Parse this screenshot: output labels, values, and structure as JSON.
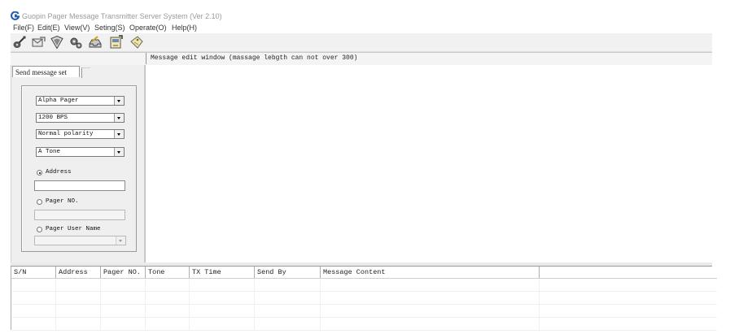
{
  "window": {
    "title": "Guopin Pager   Message Transmitter Server System (Ver 2.10)"
  },
  "menu": [
    {
      "label": "File(F)"
    },
    {
      "label": "Edit(E)"
    },
    {
      "label": "View(V)"
    },
    {
      "label": "Seting(S)"
    },
    {
      "label": "Operate(O)"
    },
    {
      "label": "Help(H)"
    }
  ],
  "toolbar": {
    "buttons": [
      {
        "icon": "guitar-icon"
      },
      {
        "icon": "send-message-icon"
      },
      {
        "icon": "shield-icon"
      },
      {
        "icon": "gears-icon"
      },
      {
        "icon": "inbox-icon"
      },
      {
        "icon": "export-icon"
      },
      {
        "icon": "tag-icon"
      }
    ]
  },
  "header": {
    "title": "Message edit window (massage lebgth can not over 300)"
  },
  "left_panel": {
    "tab_label": "Send message set",
    "pager_type": "Alpha Pager",
    "baud_rate": "1200 BPS",
    "polarity": "Normal polarity",
    "tone": "A Tone",
    "radio_address": "Address",
    "radio_pager_no": "Pager NO.",
    "radio_user_name": "Pager User Name",
    "address_value": "",
    "pager_no_value": "",
    "user_name_value": ""
  },
  "message_log": {
    "columns": [
      "S/N",
      "Address",
      "Pager NO.",
      "Tone",
      "TX Time",
      "Send By",
      "Message Content"
    ]
  },
  "colors": {
    "logo_blue": "#1f5fa8",
    "toolbar_bg": "#f1f1f1",
    "panel_bg": "#efefef"
  }
}
